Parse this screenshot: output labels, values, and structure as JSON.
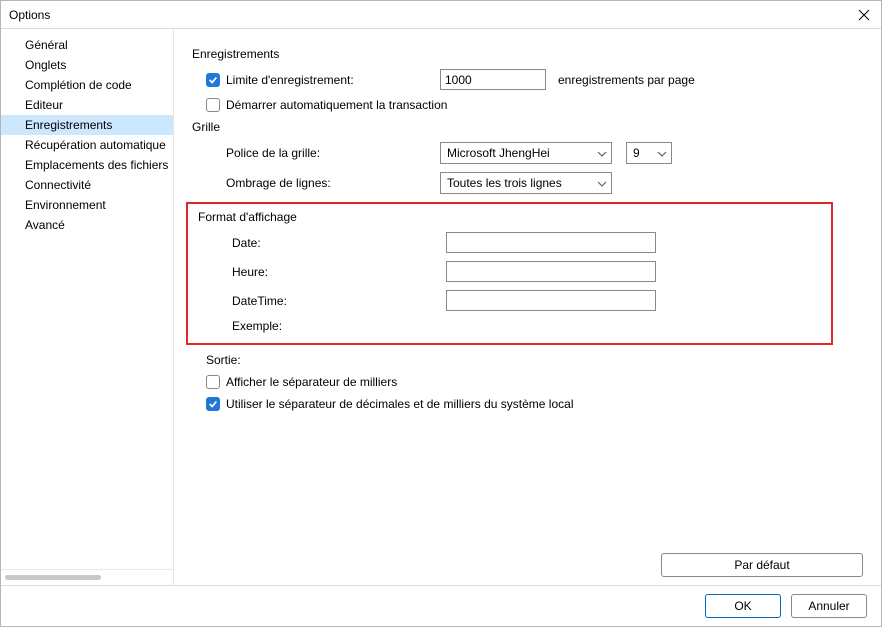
{
  "window": {
    "title": "Options"
  },
  "sidebar": {
    "items": [
      {
        "label": "Général"
      },
      {
        "label": "Onglets"
      },
      {
        "label": "Complétion de code"
      },
      {
        "label": "Editeur"
      },
      {
        "label": "Enregistrements",
        "selected": true
      },
      {
        "label": "Récupération automatique"
      },
      {
        "label": "Emplacements des fichiers"
      },
      {
        "label": "Connectivité"
      },
      {
        "label": "Environnement"
      },
      {
        "label": "Avancé"
      }
    ]
  },
  "records": {
    "title": "Enregistrements",
    "limit_label": "Limite d'enregistrement:",
    "limit_value": "1000",
    "limit_suffix": "enregistrements par page",
    "limit_checked": true,
    "autostart_label": "Démarrer automatiquement la transaction",
    "autostart_checked": false
  },
  "grid": {
    "title": "Grille",
    "font_label": "Police de la grille:",
    "font_value": "Microsoft JhengHei",
    "font_size": "9",
    "shading_label": "Ombrage de lignes:",
    "shading_value": "Toutes les trois lignes"
  },
  "format": {
    "title": "Format d'affichage",
    "date_label": "Date:",
    "date_value": "",
    "time_label": "Heure:",
    "time_value": "",
    "datetime_label": "DateTime:",
    "datetime_value": "",
    "example_label": "Exemple:"
  },
  "output": {
    "title": "Sortie:",
    "thousands_label": "Afficher le séparateur de milliers",
    "thousands_checked": false,
    "syslocale_label": "Utiliser le séparateur de décimales et de milliers du système local",
    "syslocale_checked": true
  },
  "footer": {
    "default_btn": "Par défaut",
    "ok_btn": "OK",
    "cancel_btn": "Annuler"
  }
}
